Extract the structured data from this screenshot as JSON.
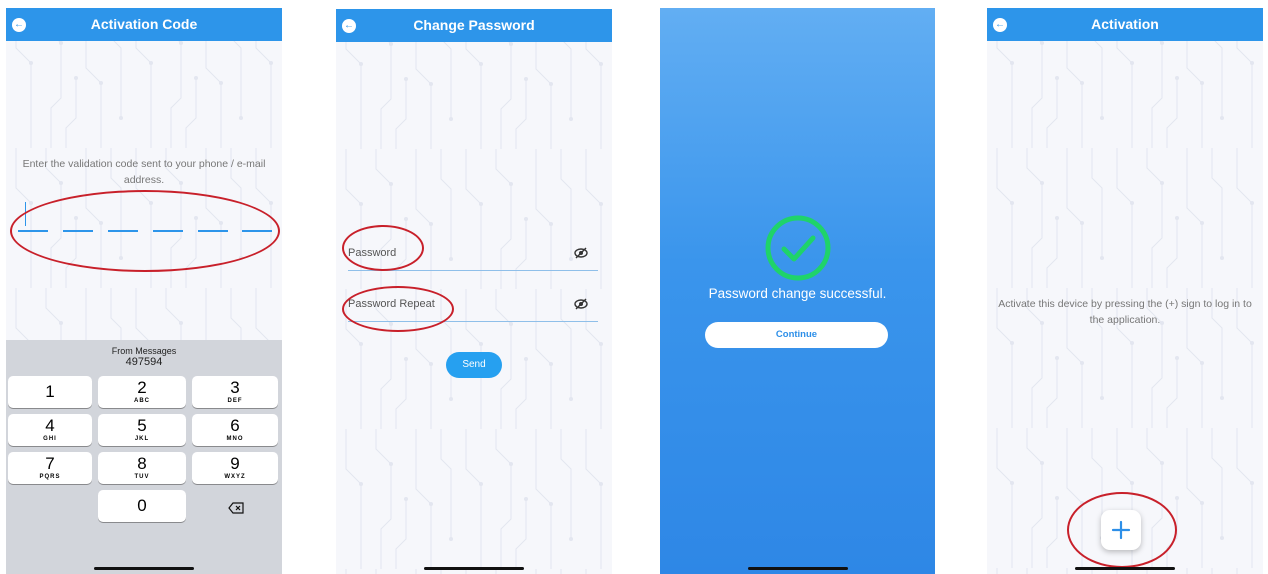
{
  "screen1": {
    "title": "Activation Code",
    "prompt": "Enter the validation code sent to your phone / e-mail address.",
    "suggestion_label": "From Messages",
    "suggestion_code": "497594",
    "keys": [
      {
        "num": "1",
        "sub": ""
      },
      {
        "num": "2",
        "sub": "ABC"
      },
      {
        "num": "3",
        "sub": "DEF"
      },
      {
        "num": "4",
        "sub": "GHI"
      },
      {
        "num": "5",
        "sub": "JKL"
      },
      {
        "num": "6",
        "sub": "MNO"
      },
      {
        "num": "7",
        "sub": "PQRS"
      },
      {
        "num": "8",
        "sub": "TUV"
      },
      {
        "num": "9",
        "sub": "WXYZ"
      },
      {
        "num": "0",
        "sub": ""
      }
    ]
  },
  "screen2": {
    "title": "Change Password",
    "password_label": "Password",
    "password_repeat_label": "Password Repeat",
    "send_label": "Send"
  },
  "screen3": {
    "message": "Password change successful.",
    "continue_label": "Continue"
  },
  "screen4": {
    "title": "Activation",
    "message": "Activate this device by pressing the (+) sign to log in to the application."
  },
  "colors": {
    "appbar": "#2d95ea",
    "annotation": "#c8202a",
    "success_check": "#1fd36a"
  },
  "icons": [
    "back-arrow-icon",
    "eye-off-icon",
    "check-circle-icon",
    "plus-icon",
    "backspace-icon"
  ]
}
